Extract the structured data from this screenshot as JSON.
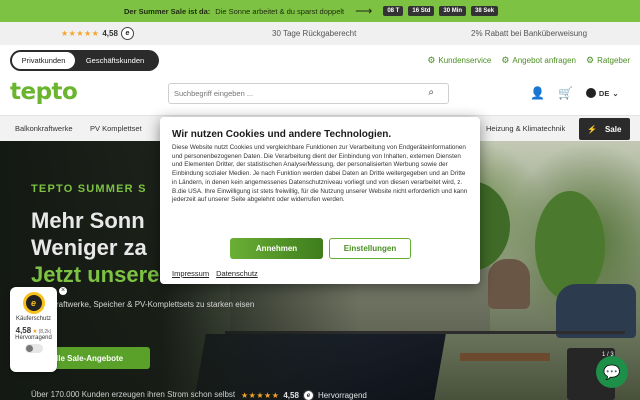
{
  "promo": {
    "label": "Der Summer Sale ist da:",
    "text": "Die Sonne arbeitet & du sparst doppelt",
    "arrow": "⟶",
    "countdown": [
      "08 T",
      "16 Std",
      "30 Min",
      "38 Sek"
    ]
  },
  "trust_bar": {
    "stars": "★★★★★",
    "rating": "4,58",
    "badge_letter": "e",
    "claim1": "30 Tage Rückgaberecht",
    "claim2": "2% Rabatt bei Banküberweisung"
  },
  "header": {
    "segments": [
      "Privatkunden",
      "Geschäftskunden"
    ],
    "links": [
      {
        "label": "Kundenservice",
        "icon": "⚙"
      },
      {
        "label": "Angebot anfragen",
        "icon": "⚙"
      },
      {
        "label": "Ratgeber",
        "icon": "⚙"
      }
    ],
    "logo": "tepto",
    "search_placeholder": "Suchbegriff eingeben ...",
    "search_icon": "⌕",
    "account_icon": "👤",
    "cart_icon": "🛒",
    "language": "DE",
    "lang_chevron": "⌄"
  },
  "nav": {
    "items": [
      "Balkonkraftwerke",
      "PV Komplettset",
      "Heizung & Klimatechnik"
    ],
    "sale": "Sale",
    "sale_icon": "⚡"
  },
  "hero": {
    "kicker": "TEPTO SUMMER S",
    "line1": "Mehr Sonn",
    "line2": "Weniger za",
    "line3": "Jetzt unsere",
    "subtitle": "raftwerke, Speicher & PV-Komplettsets zu starken eisen",
    "cta": "lle Sale-Angebote",
    "footer_text": "Über 170.000 Kunden erzeugen ihren Strom schon selbst",
    "rating_stars": "★★★★★",
    "rating": "4,58",
    "rating_label": "Hervorragend",
    "pager": "1 / 3",
    "chat_icon": "💬"
  },
  "trusted_badge": {
    "letter": "e",
    "label": "Käuferschutz",
    "score": "4,58",
    "star": "★",
    "count": "(8,2k)",
    "verdict": "Hervorragend",
    "close": "×"
  },
  "cookie_modal": {
    "title": "Wir nutzen Cookies und andere Technologien.",
    "body": "Diese Website nutzt Cookies und vergleichbare Funktionen zur Verarbeitung von Endgeräteinformationen und personenbezogenen Daten. Die Verarbeitung dient der Einbindung von Inhalten, externen Diensten und Elementen Dritter, der statistischen Analyse/Messung, der personalisierten Werbung sowie der Einbindung sozialer Medien. Je nach Funktion werden dabei Daten an Dritte weitergegeben und an Dritte in Ländern, in denen kein angemessenes Datenschutzniveau vorliegt und von diesen verarbeitet wird, z. B.die USA. Ihre Einwilligung ist stets freiwillig, für die Nutzung unserer Website nicht erforderlich und kann jederzeit auf unserer Seite abgelehnt oder widerrufen werden.",
    "accept": "Annehmen",
    "settings": "Einstellungen",
    "impressum": "Impressum",
    "datenschutz": "Datenschutz"
  }
}
